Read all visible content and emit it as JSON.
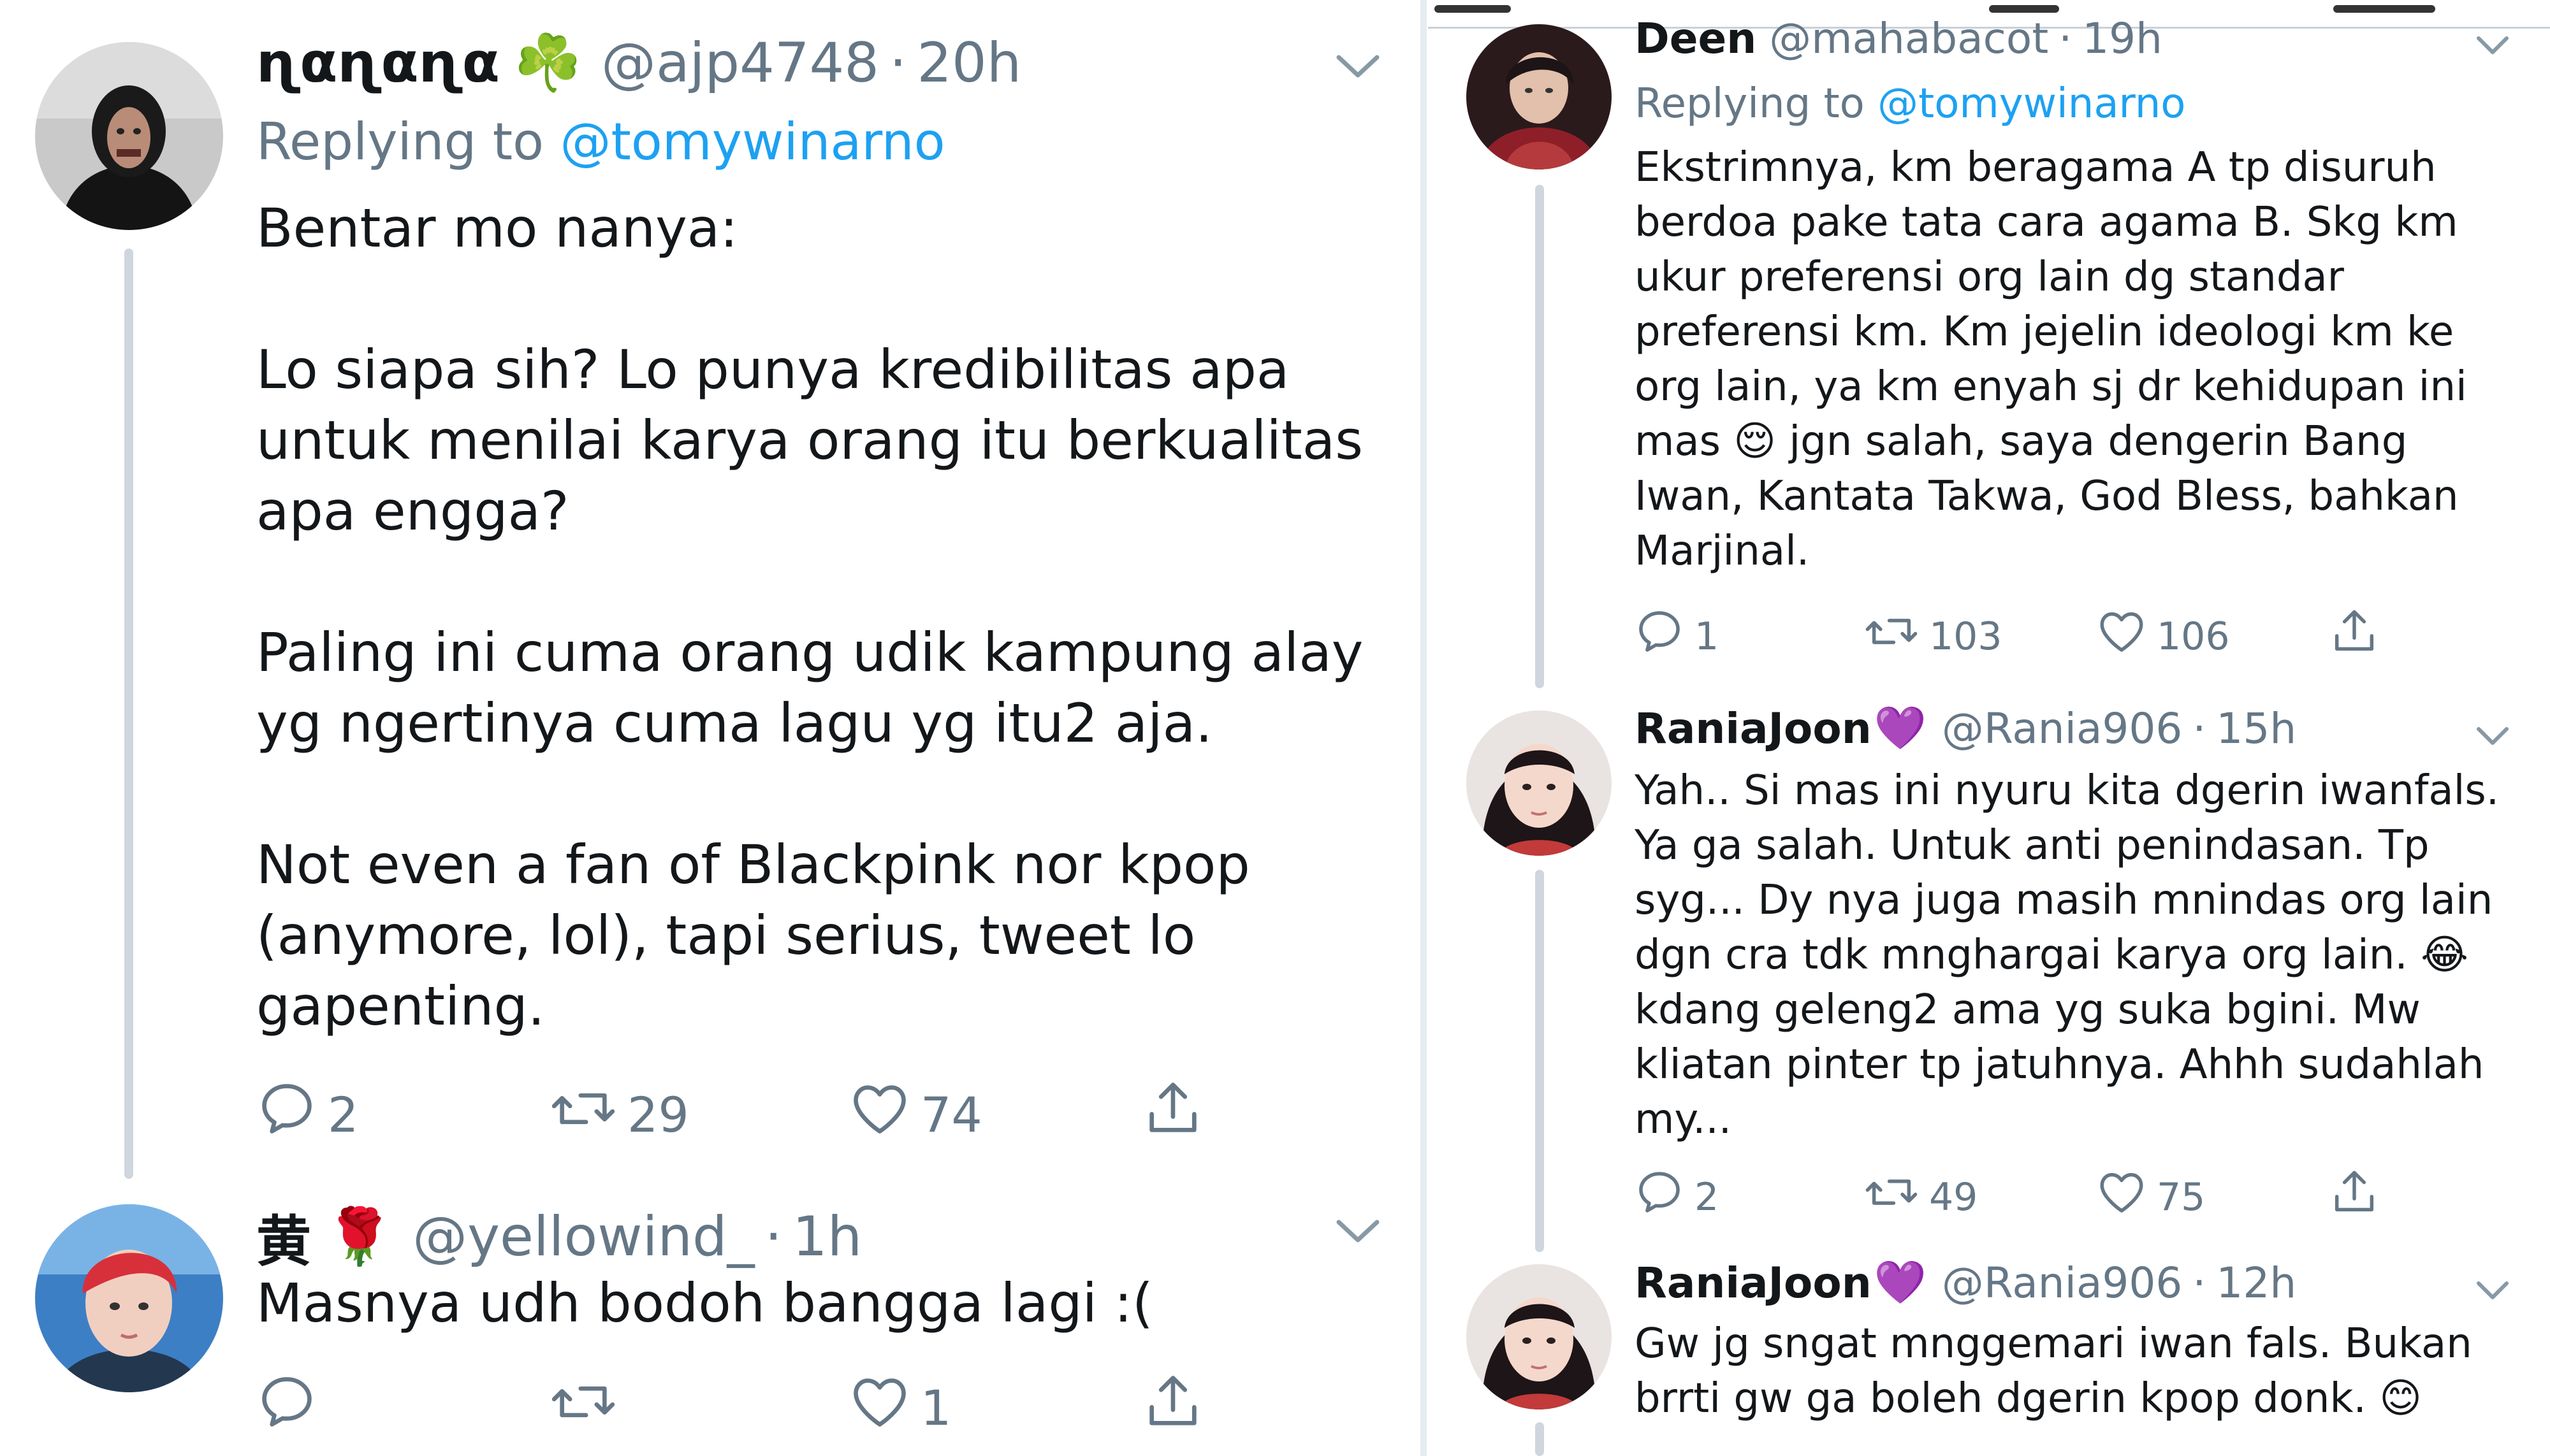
{
  "left": {
    "tweets": [
      {
        "name": "ɳαɳαɳα",
        "emoji": "☘️",
        "handle": "@ajp4748",
        "dot": "·",
        "time": "20h",
        "reply_label": "Replying to",
        "reply_mention": "@tomywinarno",
        "paragraphs": [
          "Bentar mo nanya:",
          "Lo siapa sih? Lo punya kredibilitas apa untuk menilai karya orang itu berkualitas apa engga?",
          "Paling ini cuma orang udik kampung alay yg ngertinya cuma lagu yg itu2 aja.",
          "Not even a fan of Blackpink nor kpop (anymore, lol), tapi serius, tweet lo gapenting."
        ],
        "replies": "2",
        "retweets": "29",
        "likes": "74"
      },
      {
        "name": "黄",
        "emoji": "🌹",
        "handle": "@yellowind_",
        "dot": "·",
        "time": "1h",
        "text": "Masnya udh bodoh bangga lagi :(",
        "replies": "",
        "retweets": "",
        "likes": "1"
      }
    ]
  },
  "right": {
    "tweets": [
      {
        "name": "Deen",
        "handle": "@mahabacot",
        "dot": "·",
        "time": "19h",
        "reply_label": "Replying to",
        "reply_mention": "@tomywinarno",
        "text": "Ekstrimnya, km beragama A tp disuruh berdoa pake tata cara agama B. Skg km ukur preferensi org lain dg standar preferensi km. Km jejelin ideologi km ke org lain, ya km enyah sj dr kehidupan ini mas 😌 jgn salah, saya dengerin Bang Iwan, Kantata Takwa, God Bless, bahkan Marjinal.",
        "replies": "1",
        "retweets": "103",
        "likes": "106"
      },
      {
        "name": "RaniaJoon",
        "emoji": "💜",
        "handle": "@Rania906",
        "dot": "·",
        "time": "15h",
        "text": "Yah.. Si mas ini nyuru kita dgerin iwanfals. Ya ga salah. Untuk anti penindasan. Tp syg... Dy nya juga masih mnindas org lain dgn cra tdk mnghargai karya org lain. 😂 kdang geleng2 ama yg suka bgini. Mw kliatan pinter tp jatuhnya. Ahhh sudahlah my...",
        "replies": "2",
        "retweets": "49",
        "likes": "75"
      },
      {
        "name": "RaniaJoon",
        "emoji": "💜",
        "handle": "@Rania906",
        "dot": "·",
        "time": "12h",
        "text": "Gw jg sngat mnggemari iwan fals. Bukan brrti gw ga boleh dgerin kpop donk. 😊"
      }
    ]
  },
  "icons": {
    "reply": "reply-icon",
    "retweet": "retweet-icon",
    "like": "heart-icon",
    "share": "share-icon",
    "more": "chevron-down-icon"
  },
  "colors": {
    "text": "#14171a",
    "secondary": "#657786",
    "link": "#1da1f2",
    "thread_line": "#cfd6dd"
  }
}
